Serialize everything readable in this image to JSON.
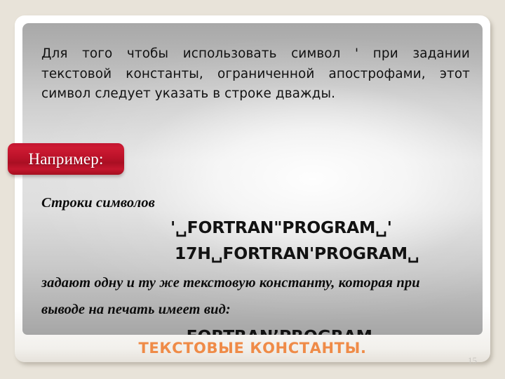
{
  "slide": {
    "intro_paragraph": "Для того чтобы использовать символ ' при задании текстовой константы, ограниченной апострофами, этот символ следует указать в строке дважды.",
    "example_badge_label": "Например:",
    "body": {
      "lead_line": "Строки символов",
      "code_line_1": "'␣FORTRAN\"PROGRAM␣'",
      "code_line_2": "17H␣FORTRAN'PROGRAM␣",
      "explanation_line_1": "задают одну и ту же текстовую константу, которая при",
      "explanation_line_2": "выводе на печать имеет вид:",
      "code_line_3": "␣FORTRAN’PROGRAM␣"
    },
    "title": "ТЕКСТОВЫЕ КОНСТАНТЫ.",
    "page_number": "15"
  },
  "colors": {
    "background": "#e8e3d9",
    "title_orange": "#ef8b48",
    "badge_red": "#bb1229",
    "text_black": "#121212",
    "page_number_gray": "#c9c6c0"
  }
}
